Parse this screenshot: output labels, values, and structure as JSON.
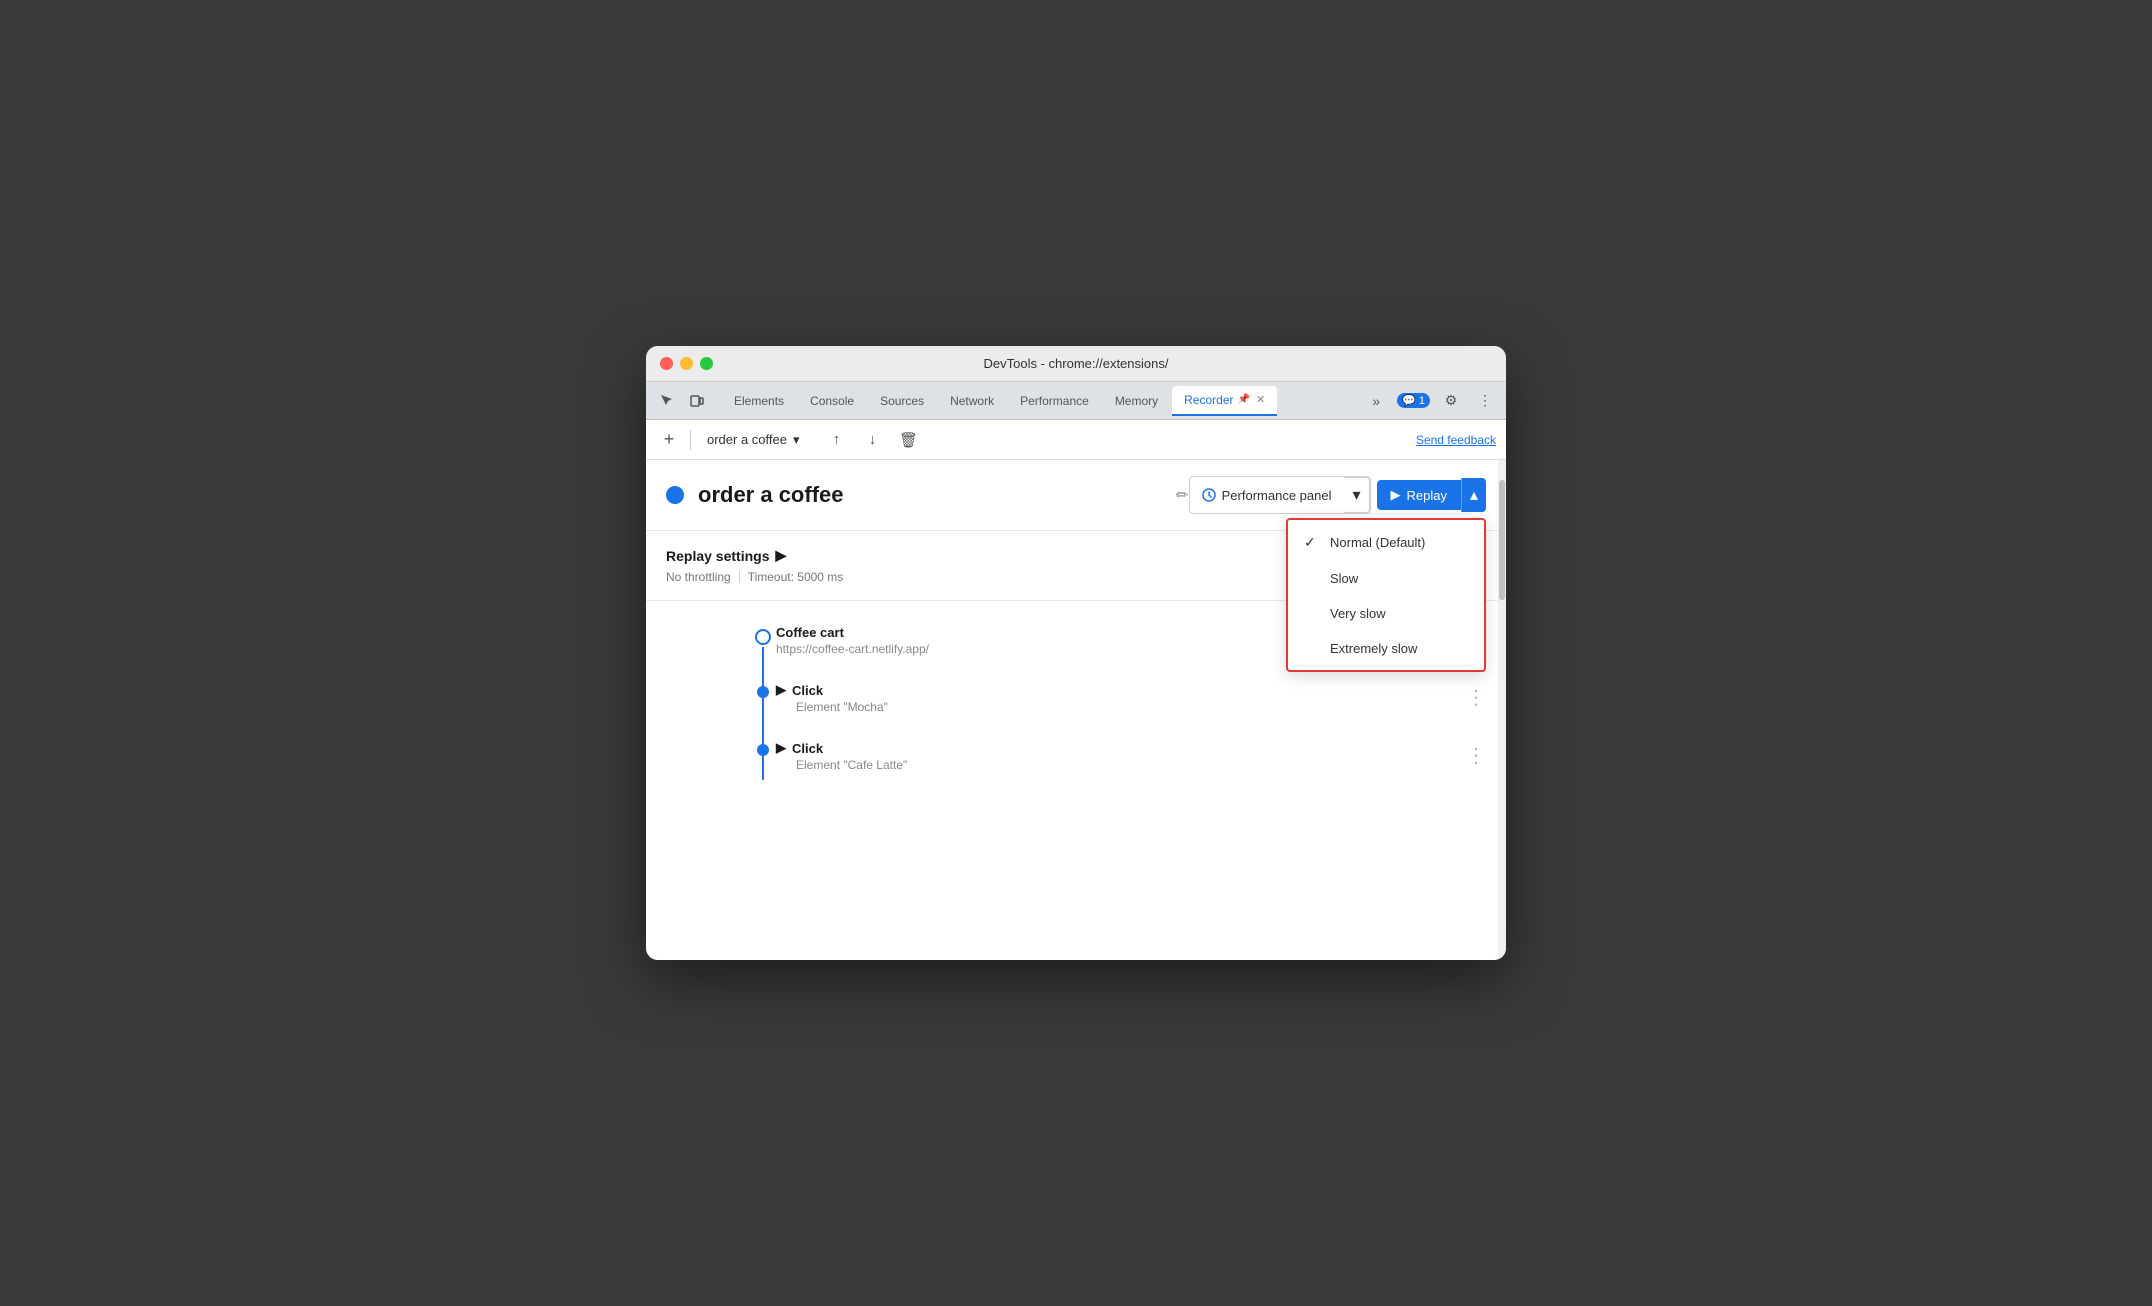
{
  "window": {
    "title": "DevTools - chrome://extensions/"
  },
  "tabbar": {
    "tabs": [
      {
        "label": "Elements",
        "active": false
      },
      {
        "label": "Console",
        "active": false
      },
      {
        "label": "Sources",
        "active": false
      },
      {
        "label": "Network",
        "active": false
      },
      {
        "label": "Performance",
        "active": false
      },
      {
        "label": "Memory",
        "active": false
      },
      {
        "label": "Recorder",
        "active": true
      }
    ],
    "more_label": "»",
    "chat_count": "1",
    "settings_icon": "⚙",
    "more_options_icon": "⋮"
  },
  "toolbar": {
    "add_label": "+",
    "recording_name": "order a coffee",
    "dropdown_icon": "▾",
    "upload_icon": "↑",
    "download_icon": "↓",
    "delete_icon": "🗑",
    "send_feedback_label": "Send feedback"
  },
  "recording": {
    "title": "order a coffee",
    "edit_icon": "✏",
    "performance_panel_label": "Performance panel",
    "replay_label": "Replay"
  },
  "replay_settings": {
    "title": "Replay settings",
    "expand_icon": "▶",
    "no_throttling": "No throttling",
    "timeout": "Timeout: 5000 ms"
  },
  "dropdown": {
    "items": [
      {
        "label": "Normal (Default)",
        "selected": true
      },
      {
        "label": "Slow",
        "selected": false
      },
      {
        "label": "Very slow",
        "selected": false
      },
      {
        "label": "Extremely slow",
        "selected": false
      }
    ]
  },
  "steps": [
    {
      "type": "navigate",
      "title": "Coffee cart",
      "subtitle": "https://coffee-cart.netlify.app/",
      "dot_open": true
    },
    {
      "type": "click",
      "title": "Click",
      "subtitle": "Element \"Mocha\"",
      "dot_open": false
    },
    {
      "type": "click",
      "title": "Click",
      "subtitle": "Element \"Cafe Latte\"",
      "dot_open": false
    }
  ]
}
